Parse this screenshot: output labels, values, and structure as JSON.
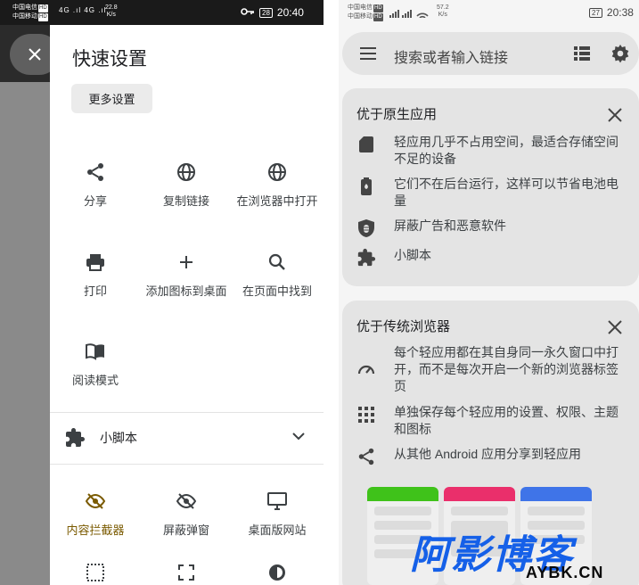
{
  "left_status": {
    "carrier1": "中国电信",
    "carrier2": "中国移动",
    "hd": "HD",
    "network": "4G .ıl 4G .ıl",
    "speed_value": "22.8",
    "speed_unit": "K/s",
    "battery": "28",
    "time": "20:40"
  },
  "left": {
    "title": "快速设置",
    "more_settings": "更多设置",
    "actions": [
      {
        "label": "分享",
        "icon": "share-icon"
      },
      {
        "label": "复制链接",
        "icon": "globe-icon"
      },
      {
        "label": "在浏览器中打开",
        "icon": "globe-icon"
      },
      {
        "label": "打印",
        "icon": "print-icon"
      },
      {
        "label": "添加图标到桌面",
        "icon": "add-icon"
      },
      {
        "label": "在页面中找到",
        "icon": "search-icon"
      },
      {
        "label": "阅读模式",
        "icon": "book-icon"
      }
    ],
    "userscript_label": "小脚本",
    "toggles": [
      {
        "label": "内容拦截器",
        "icon": "eye-off-icon",
        "active": true
      },
      {
        "label": "屏蔽弹窗",
        "icon": "eye-off-icon",
        "active": false
      },
      {
        "label": "桌面版网站",
        "icon": "monitor-icon",
        "active": false
      }
    ],
    "accent_color": "#7a5a00"
  },
  "right_status": {
    "carrier1": "中国电信",
    "carrier2": "中国移动",
    "hd": "HD",
    "speed_value": "57.2",
    "speed_unit": "K/s",
    "battery": "27",
    "time": "20:38"
  },
  "right": {
    "search_placeholder": "搜索或者输入链接",
    "card1": {
      "title": "优于原生应用",
      "rows": [
        {
          "icon": "sd-card-icon",
          "text": "轻应用几乎不占用空间，最适合存储空间不足的设备"
        },
        {
          "icon": "battery-icon",
          "text": "它们不在后台运行，这样可以节省电池电量"
        },
        {
          "icon": "shield-bug-icon",
          "text": "屏蔽广告和恶意软件"
        },
        {
          "icon": "puzzle-icon",
          "text": "小脚本"
        }
      ]
    },
    "card2": {
      "title": "优于传统浏览器",
      "rows": [
        {
          "icon": "speedometer-icon",
          "text": "每个轻应用都在其自身同一永久窗口中打开，而不是每次开启一个新的浏览器标签页"
        },
        {
          "icon": "apps-grid-icon",
          "text": "单独保存每个轻应用的设置、权限、主题和图标"
        },
        {
          "icon": "share-icon",
          "text": "从其他 Android 应用分享到轻应用"
        }
      ]
    },
    "preview_colors": [
      "#3fc21a",
      "#ea2f6b",
      "#3f74e8"
    ]
  },
  "watermark": {
    "main": "阿影博客",
    "sub": "AYBK.CN"
  }
}
